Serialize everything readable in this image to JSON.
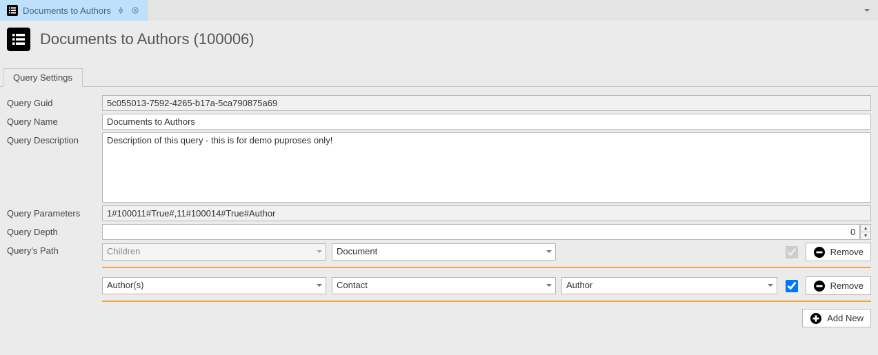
{
  "tab": {
    "title": "Documents to Authors"
  },
  "header": {
    "title": "Documents to Authors (100006)"
  },
  "inner_tabs": [
    {
      "label": "Query Settings"
    }
  ],
  "labels": {
    "guid": "Query Guid",
    "name": "Query Name",
    "desc": "Query Description",
    "params": "Query Parameters",
    "depth": "Query Depth",
    "path": "Query's Path"
  },
  "fields": {
    "guid": "5c055013-7592-4265-b17a-5ca790875a69",
    "name": "Documents to Authors",
    "desc": "Description of this query - this is for demo puproses only!",
    "params": "1#100011#True#,11#100014#True#Author",
    "depth": "0"
  },
  "path_rows": [
    {
      "a": "Children",
      "b": "Document",
      "c": "",
      "checked": true,
      "check_enabled": false
    },
    {
      "a": "Author(s)",
      "b": "Contact",
      "c": "Author",
      "checked": true,
      "check_enabled": true
    }
  ],
  "buttons": {
    "remove": "Remove",
    "addnew": "Add New"
  }
}
